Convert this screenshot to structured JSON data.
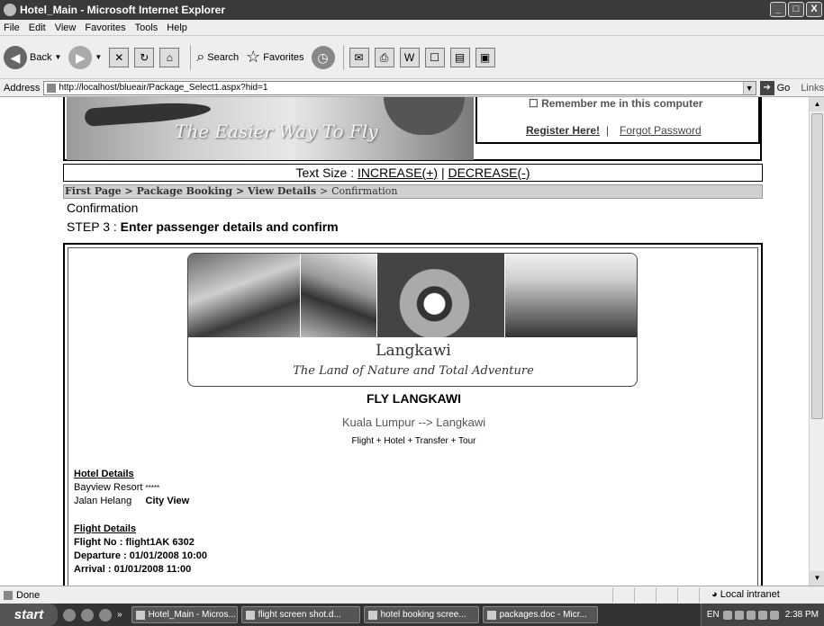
{
  "window": {
    "title": "Hotel_Main - Microsoft Internet Explorer",
    "controls": [
      "_",
      "□",
      "X"
    ]
  },
  "menu": [
    "File",
    "Edit",
    "View",
    "Favorites",
    "Tools",
    "Help"
  ],
  "toolbar": {
    "back": "Back",
    "search": "Search",
    "favorites": "Favorites"
  },
  "address": {
    "label": "Address",
    "url": "http://localhost/blueair/Package_Select1.aspx?hid=1",
    "go": "Go",
    "links": "Links"
  },
  "header": {
    "slogan": "The Easier Way To Fly",
    "remember": "Remember me in this computer",
    "register": "Register Here!",
    "separator": "|",
    "forgot": "Forgot Password"
  },
  "textsize": {
    "label": "Text Size  :",
    "increase": "INCREASE(+)",
    "separator": "|",
    "decrease": "DECREASE(-)"
  },
  "breadcrumb": {
    "items": [
      "First Page",
      "Package Booking",
      "View Details"
    ],
    "current": "Confirmation",
    "sep": ">"
  },
  "page": {
    "title": "Confirmation",
    "step_prefix": "STEP 3 :",
    "step_text": "Enter passenger details and confirm"
  },
  "package": {
    "place": "Langkawi",
    "tagline": "The Land of Nature and Total Adventure",
    "name": "FLY LANGKAWI",
    "route": "Kuala Lumpur --> Langkawi",
    "inclusions": "Flight + Hotel + Transfer + Tour"
  },
  "hotel": {
    "heading": "Hotel Details",
    "name": "Bayview Resort",
    "stars": "*****",
    "address": "Jalan Helang",
    "view": "City View"
  },
  "flight": {
    "heading": "Flight Details",
    "number_label": "Flight No   :",
    "number": "flight1AK 6302",
    "departure_label": "Departure :",
    "departure": "01/01/2008 10:00",
    "arrival_label": "Arrival       :",
    "arrival": "01/01/2008 11:00"
  },
  "status": {
    "text": "Done",
    "zone": "Local intranet"
  },
  "taskbar": {
    "start": "start",
    "tasks": [
      "Hotel_Main - Micros...",
      "flight screen shot.d...",
      "hotel booking scree...",
      "packages.doc - Micr..."
    ],
    "lang": "EN",
    "clock": "2:38 PM"
  }
}
